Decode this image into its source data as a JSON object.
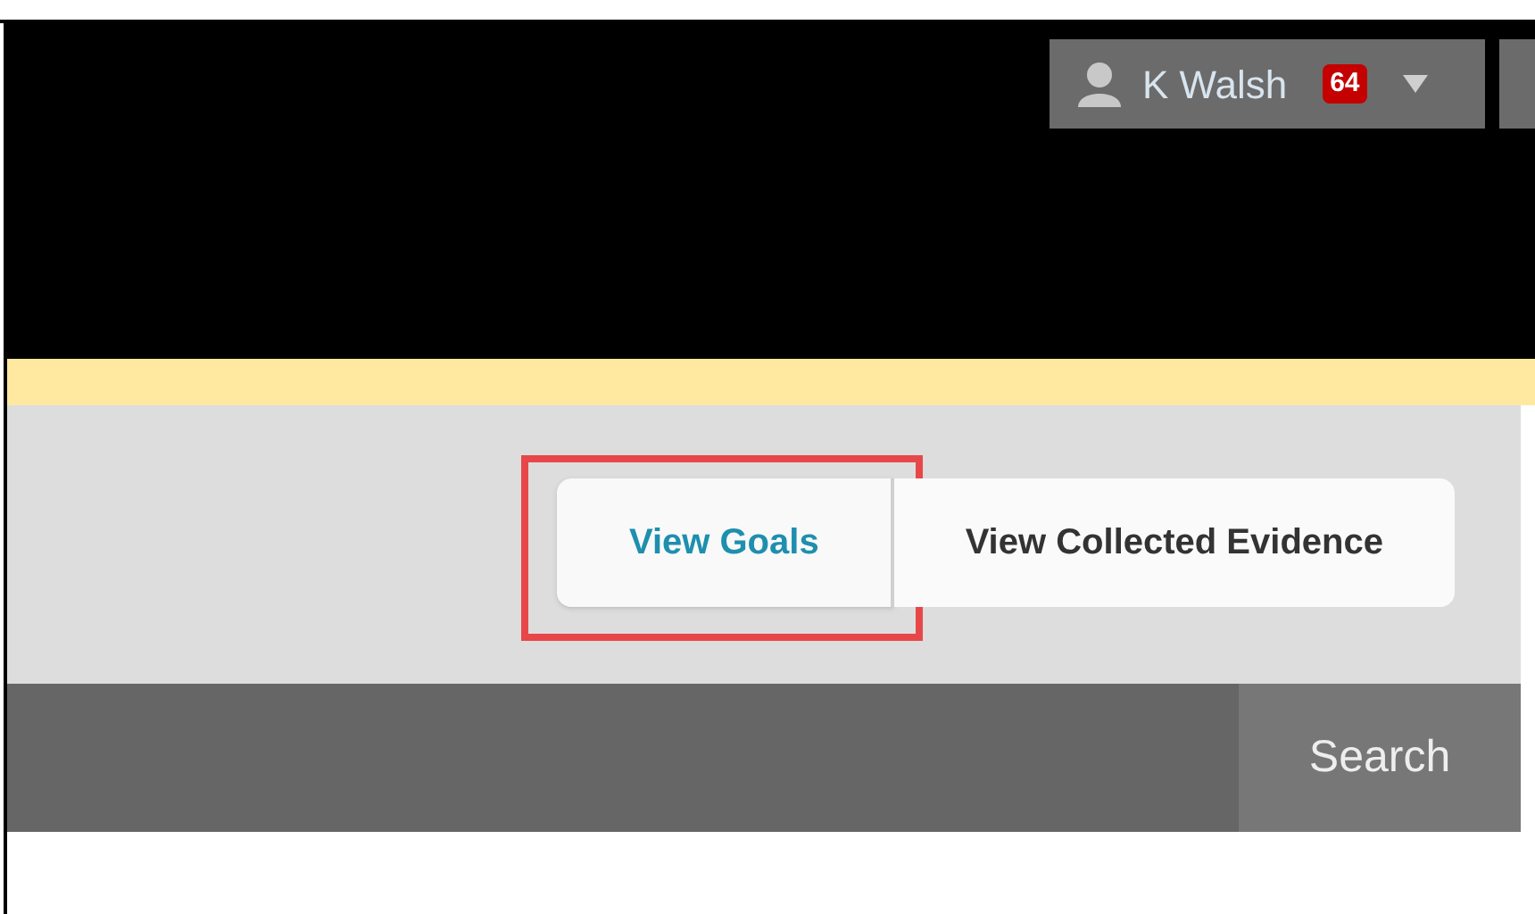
{
  "user_menu": {
    "name": "K Walsh",
    "badge": "64"
  },
  "tabs": [
    {
      "label": "View Goals",
      "selected": true,
      "highlighted": true
    },
    {
      "label": "View Collected Evidence",
      "selected": false,
      "highlighted": false
    }
  ],
  "toolbar": {
    "search_button": "Search"
  }
}
